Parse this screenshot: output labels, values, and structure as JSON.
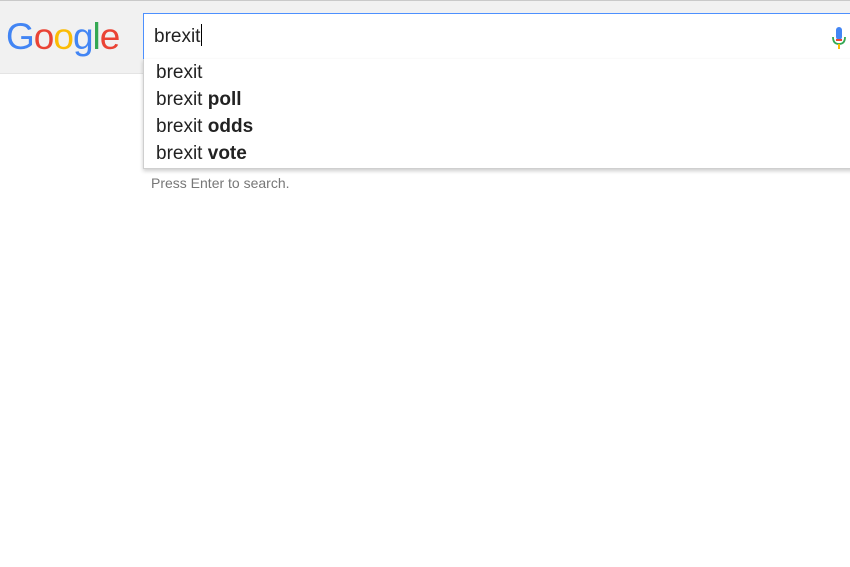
{
  "logo": {
    "letters": [
      "G",
      "o",
      "o",
      "g",
      "l",
      "e"
    ],
    "colors": [
      "#4285f4",
      "#ea4335",
      "#fbbc05",
      "#4285f4",
      "#34a853",
      "#ea4335"
    ]
  },
  "search": {
    "value": "brexit",
    "mic_icon": "microphone-icon"
  },
  "suggestions": [
    {
      "prefix": "brexit",
      "completion": ""
    },
    {
      "prefix": "brexit ",
      "completion": "poll"
    },
    {
      "prefix": "brexit ",
      "completion": "odds"
    },
    {
      "prefix": "brexit ",
      "completion": "vote"
    }
  ],
  "hint": "Press Enter to search.",
  "colors": {
    "header_bg": "#f1f1f1",
    "focus_border": "#4d90fe",
    "hint_text": "#777777"
  }
}
